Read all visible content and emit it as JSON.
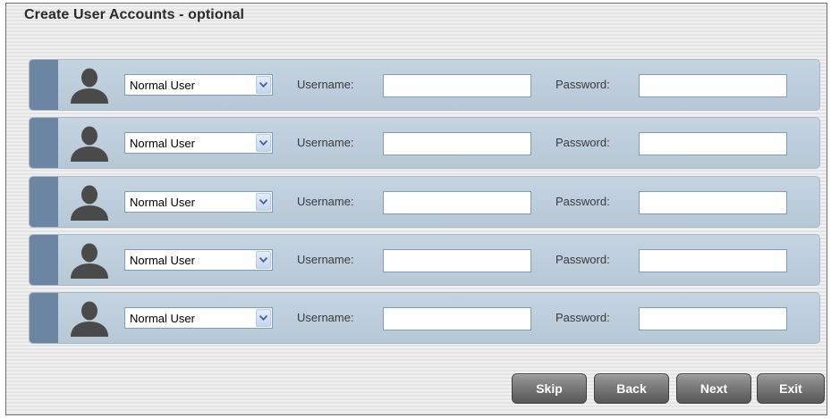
{
  "page": {
    "title": "Create User Accounts - optional"
  },
  "form": {
    "username_label": "Username:",
    "password_label": "Password:",
    "rows": [
      {
        "role": "Normal User",
        "username": "",
        "password": ""
      },
      {
        "role": "Normal User",
        "username": "",
        "password": ""
      },
      {
        "role": "Normal User",
        "username": "",
        "password": ""
      },
      {
        "role": "Normal User",
        "username": "",
        "password": ""
      },
      {
        "role": "Normal User",
        "username": "",
        "password": ""
      }
    ]
  },
  "icons": {
    "avatar": "user-silhouette-icon",
    "dropdown": "chevron-down-icon"
  },
  "footer": {
    "skip_label": "Skip",
    "back_label": "Back",
    "next_label": "Next",
    "exit_label": "Exit"
  },
  "colors": {
    "row_background": "#bccbd9",
    "row_tab": "#6b85a2",
    "avatar": "#4a4a4a",
    "button": "#6d6d6d",
    "button_text": "#ffffff"
  }
}
